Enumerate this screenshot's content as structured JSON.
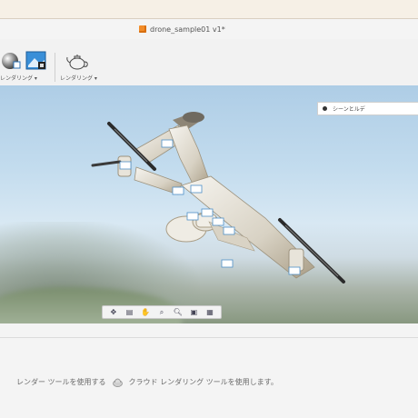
{
  "window": {
    "document_title": "drone_sample01 v1*"
  },
  "toolbar": {
    "groups": [
      {
        "label": "レンダリング ▾",
        "icon": "render-sphere-icon"
      },
      {
        "label": "レンダリング ▾",
        "icon": "teapot-render-icon"
      }
    ]
  },
  "viewport": {
    "browser_panel_label": "シーンとルデ",
    "nav_tools": [
      "orbit-icon",
      "pan-icon",
      "hand-icon",
      "zoom-window-icon",
      "zoom-icon",
      "display-icon",
      "grid-icon"
    ]
  },
  "status_bar": {
    "text_before": "レンダー ツールを使用する",
    "text_after": "クラウド レンダリング ツールを使用します。"
  },
  "colors": {
    "accent_orange": "#f28c28",
    "sky_top": "#aecde6",
    "ground": "#889880"
  }
}
